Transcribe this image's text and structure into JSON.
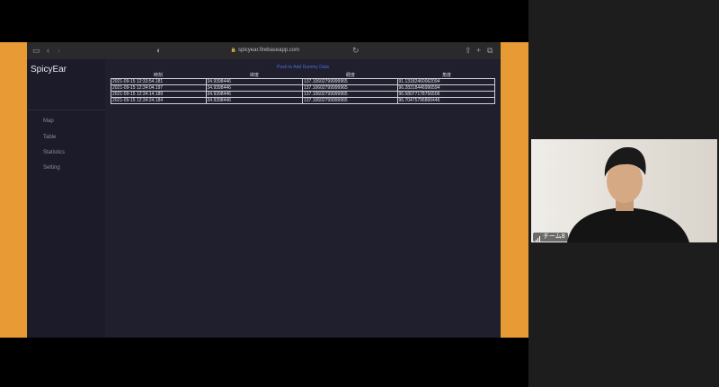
{
  "browser": {
    "url": "spicyear.firebaseapp.com",
    "controls": [
      "sidebar-toggle-icon",
      "back-arrow-icon",
      "forward-arrow-icon",
      "reader-icon",
      "reload-icon",
      "share-icon",
      "new-tab-icon",
      "tabs-icon"
    ]
  },
  "app": {
    "brand": "SpicyEar",
    "nav": [
      {
        "label": "Map"
      },
      {
        "label": "Table"
      },
      {
        "label": "Statistics"
      },
      {
        "label": "Setting"
      }
    ]
  },
  "table": {
    "title": "Push to Add Dummy Data",
    "headers": [
      "時刻",
      "緯度",
      "経度",
      "角度"
    ],
    "rows": [
      [
        "2021-09-15 12:33:54.181",
        "34.9398446",
        "137.10602799999965",
        "91.13182460062094"
      ],
      [
        "2021-09-15 12:34:04.197",
        "34.9398446",
        "137.10602799999965",
        "96.28318446996594"
      ],
      [
        "2021-09-15 12:34:14.189",
        "34.9398446",
        "137.10602799999965",
        "96.58077178756506"
      ],
      [
        "2021-09-15 12:34:24.184",
        "34.9398446",
        "137.10602799999965",
        "96.70475796866446"
      ]
    ]
  },
  "video": {
    "participant_name": "チーム8"
  },
  "colors": {
    "frame_orange": "#e89b34",
    "app_bg": "#1f1f2e",
    "sidebar_bg": "#1b1b29",
    "title_blue": "#4f6fd6"
  }
}
